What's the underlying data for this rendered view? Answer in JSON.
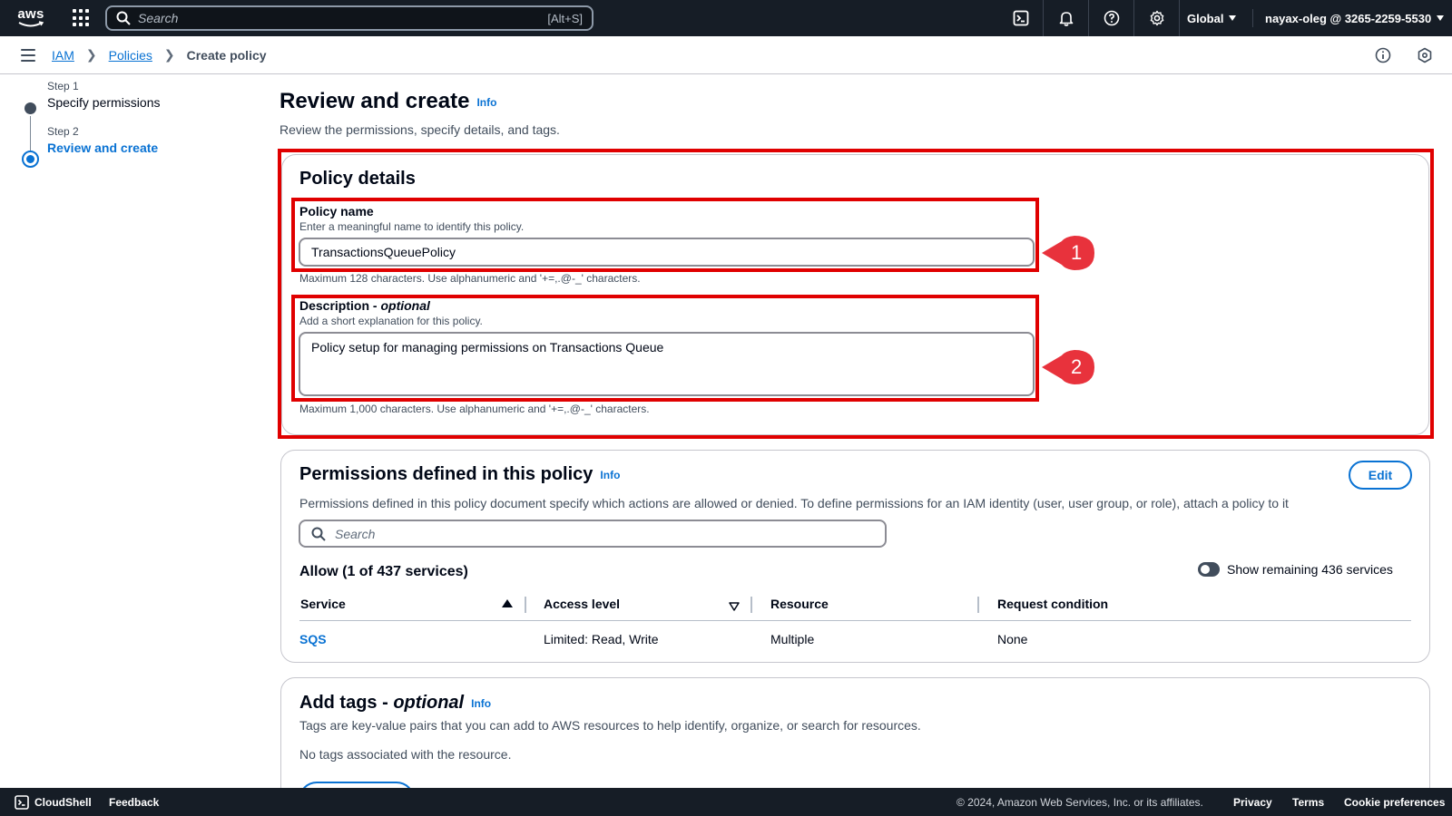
{
  "topnav": {
    "logo_text": "aws",
    "search_placeholder": "Search",
    "search_shortcut": "[Alt+S]",
    "region": "Global",
    "account": "nayax-oleg @ 3265-2259-5530"
  },
  "breadcrumb": {
    "items": [
      "IAM",
      "Policies"
    ],
    "current": "Create policy"
  },
  "steps": [
    {
      "label": "Step 1",
      "title": "Specify permissions",
      "state": "completed"
    },
    {
      "label": "Step 2",
      "title": "Review and create",
      "state": "current"
    }
  ],
  "page": {
    "title": "Review and create",
    "info": "Info",
    "description": "Review the permissions, specify details, and tags."
  },
  "policy_details": {
    "heading": "Policy details",
    "name_label": "Policy name",
    "name_desc": "Enter a meaningful name to identify this policy.",
    "name_value": "TransactionsQueuePolicy",
    "name_constraint": "Maximum 128 characters. Use alphanumeric and '+=,.@-_' characters.",
    "desc_label": "Description - ",
    "desc_label_optional": "optional",
    "desc_desc": "Add a short explanation for this policy.",
    "desc_value": "Policy setup for managing permissions on Transactions Queue",
    "desc_constraint": "Maximum 1,000 characters. Use alphanumeric and '+=,.@-_' characters.",
    "callout_1": "1",
    "callout_2": "2"
  },
  "permissions": {
    "heading": "Permissions defined in this policy",
    "info": "Info",
    "edit": "Edit",
    "description": "Permissions defined in this policy document specify which actions are allowed or denied. To define permissions for an IAM identity (user, user group, or role), attach a policy to it",
    "search_placeholder": "Search",
    "allow_title": "Allow (1 of 437 services)",
    "toggle_label": "Show remaining 436 services",
    "columns": [
      "Service",
      "Access level",
      "Resource",
      "Request condition"
    ],
    "rows": [
      {
        "service": "SQS",
        "access": "Limited: Read, Write",
        "resource": "Multiple",
        "condition": "None"
      }
    ]
  },
  "tags": {
    "heading": "Add tags - ",
    "heading_optional": "optional",
    "info": "Info",
    "description": "Tags are key-value pairs that you can add to AWS resources to help identify, organize, or search for resources.",
    "empty": "No tags associated with the resource."
  },
  "footer": {
    "cloudshell": "CloudShell",
    "feedback": "Feedback",
    "copyright": "© 2024, Amazon Web Services, Inc. or its affiliates.",
    "privacy": "Privacy",
    "terms": "Terms",
    "cookies": "Cookie preferences"
  },
  "colors": {
    "nav_bg": "#161d26",
    "link": "#0972d3",
    "highlight": "#e00000",
    "callout": "#e8323c"
  }
}
